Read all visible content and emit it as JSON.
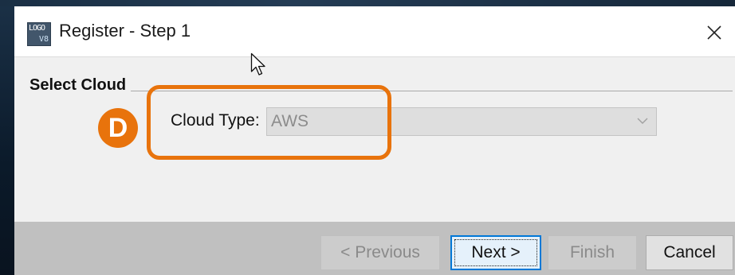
{
  "window": {
    "title": "Register - Step 1",
    "app_icon": {
      "name": "logo-icon",
      "line1": "LOGO",
      "line2": "V8"
    },
    "close_icon": "close-icon"
  },
  "section": {
    "title": "Select Cloud"
  },
  "annotation": {
    "badge_label": "D",
    "color": "#e8730c"
  },
  "form": {
    "cloud_type_label": "Cloud Type:",
    "cloud_type_value": "AWS",
    "dropdown_icon": "chevron-down-icon"
  },
  "buttons": {
    "previous": "< Previous",
    "next": "Next >",
    "finish": "Finish",
    "cancel": "Cancel"
  },
  "colors": {
    "accent": "#0078d7",
    "annotation": "#e8730c",
    "footer": "#c0c0c0",
    "dialog_background": "#f0f0f0"
  }
}
